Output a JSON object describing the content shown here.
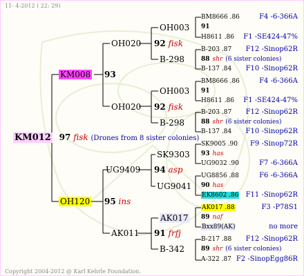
{
  "header": "11-  4-2012 ( 22: 29)",
  "footer": "Copyright 2004-2012 @ Karl Kehrle Foundation.",
  "root": {
    "name": "KM012",
    "num": "97",
    "tag": "fisk",
    "note": "(Drones from 8 sister colonies)"
  },
  "parents": {
    "dam": {
      "name": "KM008",
      "num": "93"
    },
    "sire": {
      "name": "OH120",
      "num": "95",
      "tag": "ins"
    }
  },
  "grand": {
    "g1": {
      "name": "OH020"
    },
    "g2": {
      "name": "OH020"
    },
    "g3": {
      "name": "UG9409",
      "num": "94",
      "tag": "asp"
    },
    "g4": {
      "name": "AK011",
      "num": "91",
      "tag": "frfj"
    }
  },
  "level3": {
    "a1": "OH003",
    "a2": "B-298",
    "b1": "OH003",
    "b2": "B-298",
    "c1": "SK9303",
    "c2": "UG9041",
    "d1": "AK017",
    "d2": "B-342"
  },
  "mid": {
    "m1": {
      "num": "92",
      "tag": "fisk"
    },
    "m2": {
      "num": "92",
      "tag": "fisk"
    },
    "m3": {
      "num": "94",
      "tag": "asp"
    },
    "m4": {
      "num": "91",
      "tag": "frfj"
    }
  },
  "right": [
    {
      "left": "BM8666 .86",
      "right": "F4 -6-366A"
    },
    {
      "left": "91",
      "right": ""
    },
    {
      "left": "H8611 .86",
      "right": "F1 -SE424-47%"
    },
    {
      "left": "B-203 .87",
      "right": "F12 -Sinop62R"
    },
    {
      "left": "88",
      "tag": "shr",
      "note": "(6 sister colonies)",
      "right": ""
    },
    {
      "left": "B-137 .84",
      "right": "F10 -Sinop62R"
    },
    {
      "left": "BM8666 .86",
      "right": "F4 -6-366A"
    },
    {
      "left": "91",
      "right": ""
    },
    {
      "left": "H8611 .86",
      "right": "F1 -SE424-47%"
    },
    {
      "left": "B-203 .87",
      "right": "F12 -Sinop62R"
    },
    {
      "left": "88",
      "tag": "shr",
      "note": "(6 sister colonies)",
      "right": ""
    },
    {
      "left": "B-137 .84",
      "right": "F10 -Sinop62R"
    },
    {
      "left": "SK9005 .90",
      "right": "F9 -Sinop72R"
    },
    {
      "left": "93",
      "tag": "has",
      "right": ""
    },
    {
      "left": "UG9032 .90",
      "right": "F7 -6-366A"
    },
    {
      "left": "UG8856 .88",
      "right": "F6 -6-366A"
    },
    {
      "left": "90",
      "tag": "has",
      "right": ""
    },
    {
      "left": "EK8602 .86",
      "right": "F11 -Sinop62R"
    },
    {
      "left": "AK017 .88",
      "right": "F3 -P78S1"
    },
    {
      "left": "89",
      "tag": "naf",
      "right": ""
    },
    {
      "left": "Bxx89(AK)",
      "right": "no more"
    },
    {
      "left": "B-217 .88",
      "right": "F12 -Sinop62R"
    },
    {
      "left": "89",
      "tag": "shr",
      "note": "(6 sister colonies)",
      "right": ""
    },
    {
      "left": "A-322 .87",
      "right": "F2 -SinopEgg86R"
    }
  ],
  "colors": {
    "pink": "#ff44ff",
    "yellow": "#ffff00",
    "cyan": "#22dddd",
    "red": "#cc0000",
    "blue": "#0000aa"
  }
}
